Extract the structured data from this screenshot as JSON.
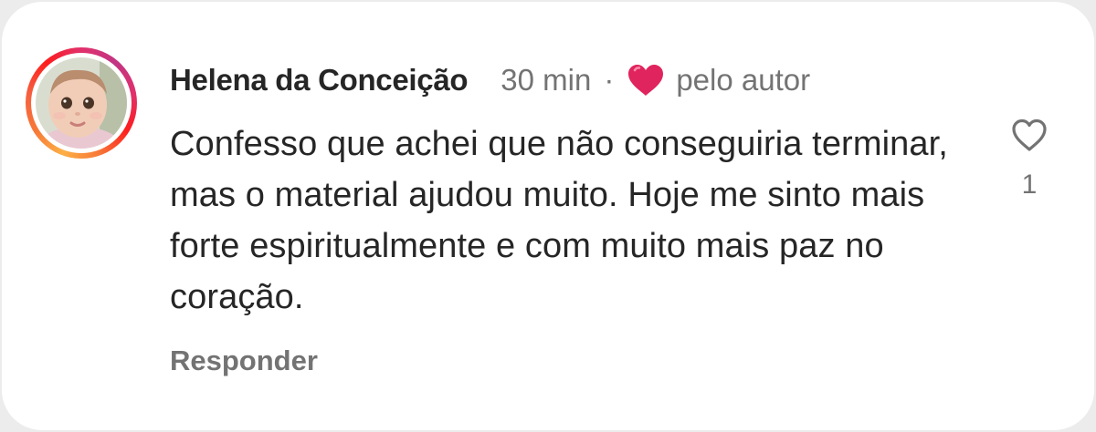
{
  "comment": {
    "author": "Helena da Conceição",
    "time": "30 min",
    "separator": "·",
    "liked_by_author_label": "pelo autor",
    "text": "Confesso que achei que não conseguiria terminar, mas o material ajudou muito. Hoje me sinto mais forte espiritualmente e com muito mais paz no coração.",
    "reply_label": "Responder",
    "like_count": "1"
  },
  "icons": {
    "author_like": "red-heart-icon",
    "like": "heart-outline-icon",
    "avatar": "avatar"
  },
  "colors": {
    "author_heart": "#e0245e",
    "ring_start": "#fcaf45",
    "ring_end": "#c13584"
  }
}
